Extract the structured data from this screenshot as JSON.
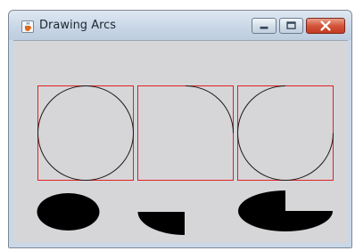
{
  "window": {
    "title": "Drawing Arcs",
    "app_icon": "java-cup-icon",
    "controls": {
      "minimize_icon": "minimize-icon",
      "maximize_icon": "maximize-icon",
      "close_icon": "close-icon"
    }
  },
  "canvas": {
    "background_color": "#d6d6d9",
    "rectangle_color": "#e02020",
    "arc_color": "#000000"
  }
}
